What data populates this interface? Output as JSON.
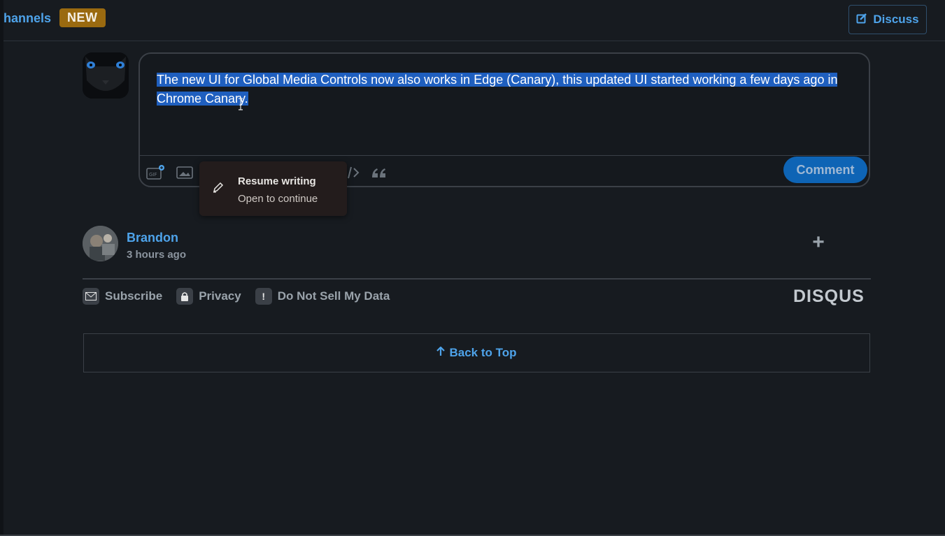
{
  "header": {
    "channels_label": "hannels",
    "new_badge": "NEW",
    "discuss_label": "Discuss"
  },
  "editor": {
    "text": "The new UI for Global Media Controls now also works in Edge (Canary), this updated UI started working a few days ago in Chrome Canary.",
    "comment_label": "Comment"
  },
  "resume_popup": {
    "title": "Resume writing",
    "subtitle": "Open to continue"
  },
  "user": {
    "name": "Brandon",
    "time": "3 hours ago"
  },
  "footer": {
    "subscribe": "Subscribe",
    "privacy": "Privacy",
    "do_not_sell": "Do Not Sell My Data",
    "logo": "DISQUS",
    "back_to_top": "Back to Top"
  },
  "colors": {
    "background": "#171b20",
    "accent": "#4ea3ea",
    "selection": "#1f5fbf",
    "comment_button": "#0e64b5",
    "badge": "#9a6a10"
  }
}
